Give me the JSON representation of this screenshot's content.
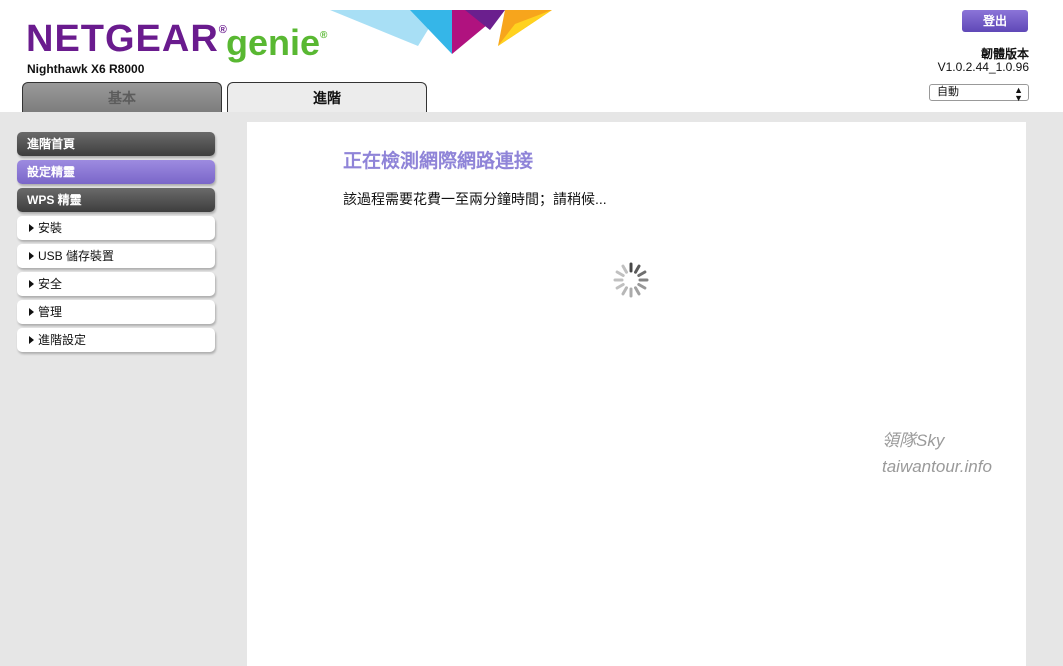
{
  "header": {
    "brand": "NETGEAR",
    "brand_reg": "®",
    "product": "genie",
    "product_reg": "®",
    "model": "Nighthawk X6 R8000",
    "logout_label": "登出",
    "firmware_label": "韌體版本",
    "firmware_version": "V1.0.2.44_1.0.96",
    "language_selected": "自動"
  },
  "tabs": [
    {
      "label": "基本"
    },
    {
      "label": "進階"
    }
  ],
  "sidebar": {
    "items": [
      {
        "label": "進階首頁"
      },
      {
        "label": "設定精靈"
      },
      {
        "label": "WPS 精靈"
      },
      {
        "label": "安裝"
      },
      {
        "label": "USB 儲存裝置"
      },
      {
        "label": "安全"
      },
      {
        "label": "管理"
      },
      {
        "label": "進階設定"
      }
    ]
  },
  "main": {
    "title": "正在檢測網際網路連接",
    "description": "該過程需要花費一至兩分鐘時間；請稍候..."
  },
  "watermark": {
    "line1": "領隊Sky",
    "line2": "taiwantour.info"
  },
  "colors": {
    "brand_purple": "#6a1b8e",
    "genie_green": "#59b832",
    "accent_purple": "#7a66c9",
    "title_purple": "#8f84d8"
  }
}
